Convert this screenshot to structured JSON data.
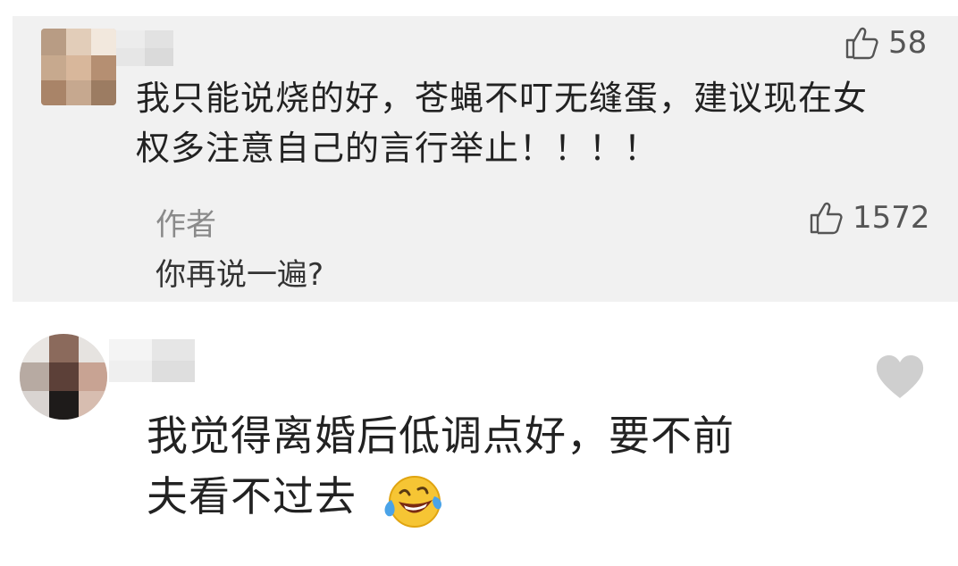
{
  "comments": [
    {
      "likes": "58",
      "text_line1": "我只能说烧的好，苍蝇不叮无缝蛋，建议现在女",
      "text_line2": "权多注意自己的言行举止！！！！",
      "reply": {
        "author": "作者",
        "text": "你再说一遍?",
        "likes": "1572"
      }
    },
    {
      "text_line1": "我觉得离婚后低调点好，要不前",
      "text_line2": "夫看不过去",
      "emoji": "laughing-crying-emoji"
    }
  ],
  "icons": {
    "like": "thumbs-up-icon",
    "heart": "heart-icon"
  },
  "colors": {
    "comment_bg": "#f1f1f1",
    "heart": "#cfcfcf",
    "muted": "#8a8a8a"
  }
}
